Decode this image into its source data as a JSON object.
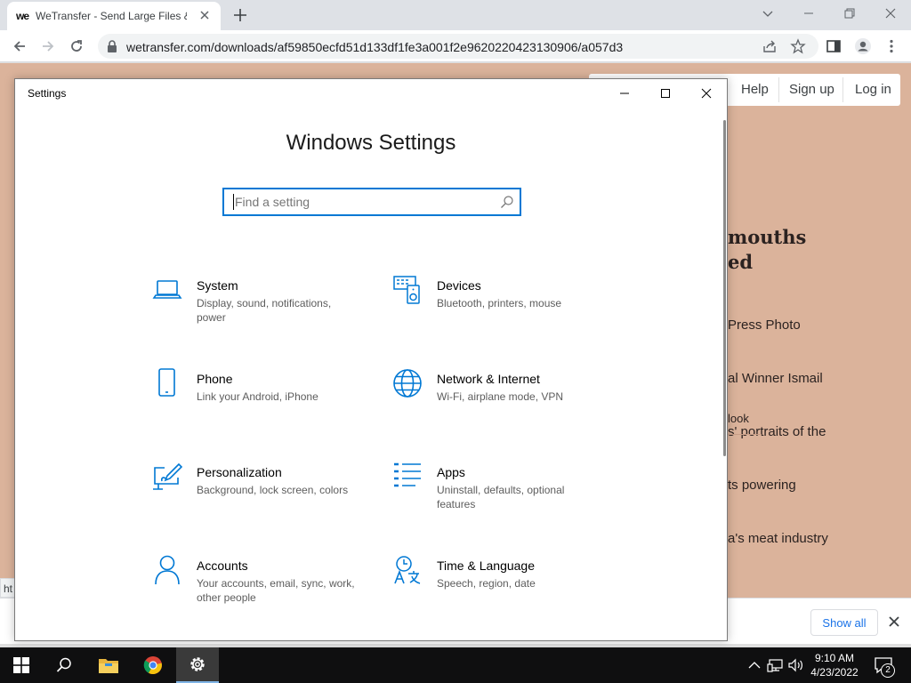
{
  "browser": {
    "tab_title": "WeTransfer - Send Large Files &",
    "tab_favicon_text": "we",
    "url": "wetransfer.com/downloads/af59850ecfd51d133df1fe3a001f2e9620220423130906/a057d3"
  },
  "page": {
    "nav": [
      "Help",
      "Sign up",
      "Log in"
    ],
    "headline_lines": [
      "mouths",
      "ed"
    ],
    "body_lines": [
      "Press Photo",
      "al Winner Ismail",
      "s' portraits of the",
      "ts powering",
      "a's meat industry"
    ],
    "look_text": "look",
    "status_tip": "ht",
    "show_all": "Show all"
  },
  "settings": {
    "window_title": "Settings",
    "heading": "Windows Settings",
    "search_placeholder": "Find a setting",
    "accent_color": "#0078d4",
    "items": [
      {
        "name": "System",
        "desc": "Display, sound, notifications, power",
        "icon": "laptop-icon"
      },
      {
        "name": "Devices",
        "desc": "Bluetooth, printers, mouse",
        "icon": "devices-icon"
      },
      {
        "name": "Phone",
        "desc": "Link your Android, iPhone",
        "icon": "phone-icon"
      },
      {
        "name": "Network & Internet",
        "desc": "Wi-Fi, airplane mode, VPN",
        "icon": "globe-icon"
      },
      {
        "name": "Personalization",
        "desc": "Background, lock screen, colors",
        "icon": "paint-icon"
      },
      {
        "name": "Apps",
        "desc": "Uninstall, defaults, optional features",
        "icon": "apps-list-icon"
      },
      {
        "name": "Accounts",
        "desc": "Your accounts, email, sync, work, other people",
        "icon": "person-icon"
      },
      {
        "name": "Time & Language",
        "desc": "Speech, region, date",
        "icon": "time-language-icon"
      }
    ]
  },
  "taskbar": {
    "time": "9:10 AM",
    "date": "4/23/2022",
    "notification_count": "2"
  }
}
